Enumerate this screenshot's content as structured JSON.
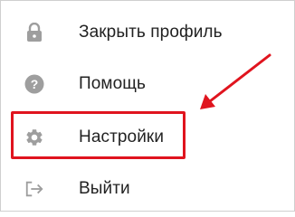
{
  "menu": {
    "items": [
      {
        "label": "Закрыть профиль",
        "icon": "lock-icon"
      },
      {
        "label": "Помощь",
        "icon": "help-circle-icon"
      },
      {
        "label": "Настройки",
        "icon": "gear-icon"
      },
      {
        "label": "Выйти",
        "icon": "logout-icon"
      }
    ]
  },
  "annotation": {
    "color": "#e0141e",
    "highlighted_item": "Настройки"
  },
  "colors": {
    "icon": "#9e9e9e",
    "text": "#222222",
    "border": "#cfcfcf"
  }
}
